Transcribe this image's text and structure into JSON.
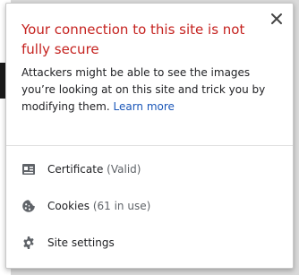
{
  "popup": {
    "title": "Your connection to this site is not fully secure",
    "description": "Attackers might be able to see the images you’re looking at on this site and trick you by modifying them.",
    "learn_more": "Learn more",
    "close_icon": "close-icon",
    "items": [
      {
        "label": "Certificate",
        "detail": "(Valid)",
        "icon": "certificate-icon"
      },
      {
        "label": "Cookies",
        "detail": "(61 in use)",
        "icon": "cookie-icon"
      },
      {
        "label": "Site settings",
        "detail": "",
        "icon": "gear-icon"
      }
    ]
  },
  "colors": {
    "title": "#c5221f",
    "link": "#1a56b8",
    "text": "#202124",
    "icon": "#5f6368"
  }
}
